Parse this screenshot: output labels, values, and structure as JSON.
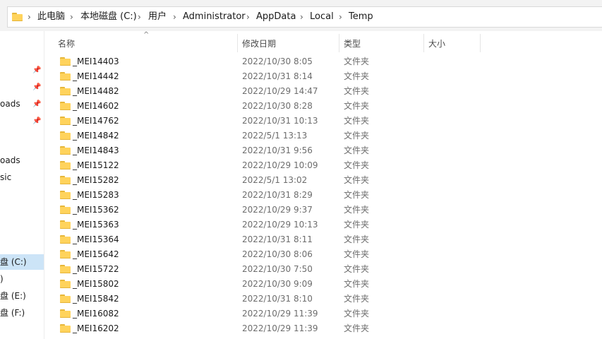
{
  "breadcrumb": {
    "items": [
      "此电脑",
      "本地磁盘 (C:)",
      "用户",
      "Administrator",
      "AppData",
      "Local",
      "Temp"
    ]
  },
  "nav": {
    "items": [
      {
        "label": "oads",
        "pinned": true
      },
      {
        "label": "oads",
        "pinned": false
      },
      {
        "label": "sic",
        "pinned": false
      },
      {
        "label": "盘 (C:)",
        "selected": true
      },
      {
        "label": ")",
        "pinned": false
      },
      {
        "label": "盘 (E:)",
        "pinned": false
      },
      {
        "label": "盘 (F:)",
        "pinned": false
      }
    ]
  },
  "columns": {
    "name": "名称",
    "date": "修改日期",
    "type": "类型",
    "size": "大小"
  },
  "files": [
    {
      "name": "_MEI14403",
      "date": "2022/10/30 8:05",
      "type": "文件夹"
    },
    {
      "name": "_MEI14442",
      "date": "2022/10/31 8:14",
      "type": "文件夹"
    },
    {
      "name": "_MEI14482",
      "date": "2022/10/29 14:47",
      "type": "文件夹"
    },
    {
      "name": "_MEI14602",
      "date": "2022/10/30 8:28",
      "type": "文件夹"
    },
    {
      "name": "_MEI14762",
      "date": "2022/10/31 10:13",
      "type": "文件夹"
    },
    {
      "name": "_MEI14842",
      "date": "2022/5/1 13:13",
      "type": "文件夹"
    },
    {
      "name": "_MEI14843",
      "date": "2022/10/31 9:56",
      "type": "文件夹"
    },
    {
      "name": "_MEI15122",
      "date": "2022/10/29 10:09",
      "type": "文件夹"
    },
    {
      "name": "_MEI15282",
      "date": "2022/5/1 13:02",
      "type": "文件夹"
    },
    {
      "name": "_MEI15283",
      "date": "2022/10/31 8:29",
      "type": "文件夹"
    },
    {
      "name": "_MEI15362",
      "date": "2022/10/29 9:37",
      "type": "文件夹"
    },
    {
      "name": "_MEI15363",
      "date": "2022/10/29 10:13",
      "type": "文件夹"
    },
    {
      "name": "_MEI15364",
      "date": "2022/10/31 8:11",
      "type": "文件夹"
    },
    {
      "name": "_MEI15642",
      "date": "2022/10/30 8:06",
      "type": "文件夹"
    },
    {
      "name": "_MEI15722",
      "date": "2022/10/30 7:50",
      "type": "文件夹"
    },
    {
      "name": "_MEI15802",
      "date": "2022/10/30 9:09",
      "type": "文件夹"
    },
    {
      "name": "_MEI15842",
      "date": "2022/10/31 8:10",
      "type": "文件夹"
    },
    {
      "name": "_MEI16082",
      "date": "2022/10/29 11:39",
      "type": "文件夹"
    },
    {
      "name": "_MEI16202",
      "date": "2022/10/29 11:39",
      "type": "文件夹"
    }
  ],
  "icons": {
    "folder": "folder-icon",
    "breadcrumb_separator": "chevron-right-icon",
    "pin": "pin-icon",
    "sort": "sort-ascending-icon"
  },
  "colors": {
    "folder": "#ffd35c",
    "selected_nav": "#cce4f7",
    "chrome": "#f3f3f3"
  }
}
